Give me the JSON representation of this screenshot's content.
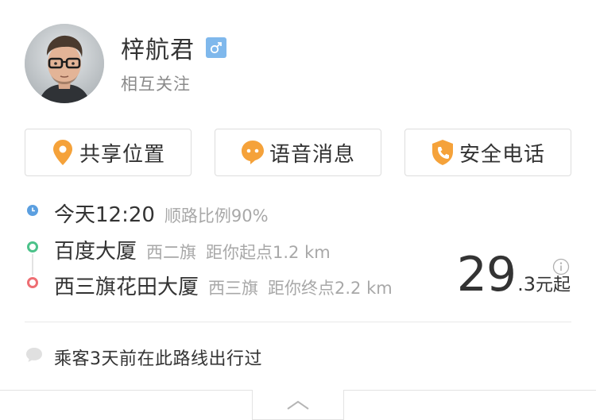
{
  "profile": {
    "name": "梓航君",
    "gender_icon": "male-icon",
    "relation": "相互关注",
    "avatar_icon": "avatar-photo"
  },
  "actions": [
    {
      "label": "共享位置",
      "icon": "location-pin-icon",
      "color": "#f5a23a"
    },
    {
      "label": "语音消息",
      "icon": "voice-message-icon",
      "color": "#f5a23a"
    },
    {
      "label": "安全电话",
      "icon": "shield-phone-icon",
      "color": "#f5a23a"
    }
  ],
  "trip": {
    "time": "今天12:20",
    "match": "顺路比例90%",
    "start_name": "百度大厦",
    "start_area": "西二旗",
    "start_distance": "距你起点1.2 km",
    "end_name": "西三旗花田大厦",
    "end_area": "西三旗",
    "end_distance": "距你终点2.2 km"
  },
  "price": {
    "integer": "29",
    "decimal": ".3",
    "unit": "元起"
  },
  "note": "乘客3天前在此路线出行过",
  "colors": {
    "accent": "#f5a23a",
    "gender_badge": "#7fb8ec",
    "time_dot": "#5b9fe0",
    "start_dot": "#4cc28a",
    "end_dot": "#ee6e73"
  }
}
